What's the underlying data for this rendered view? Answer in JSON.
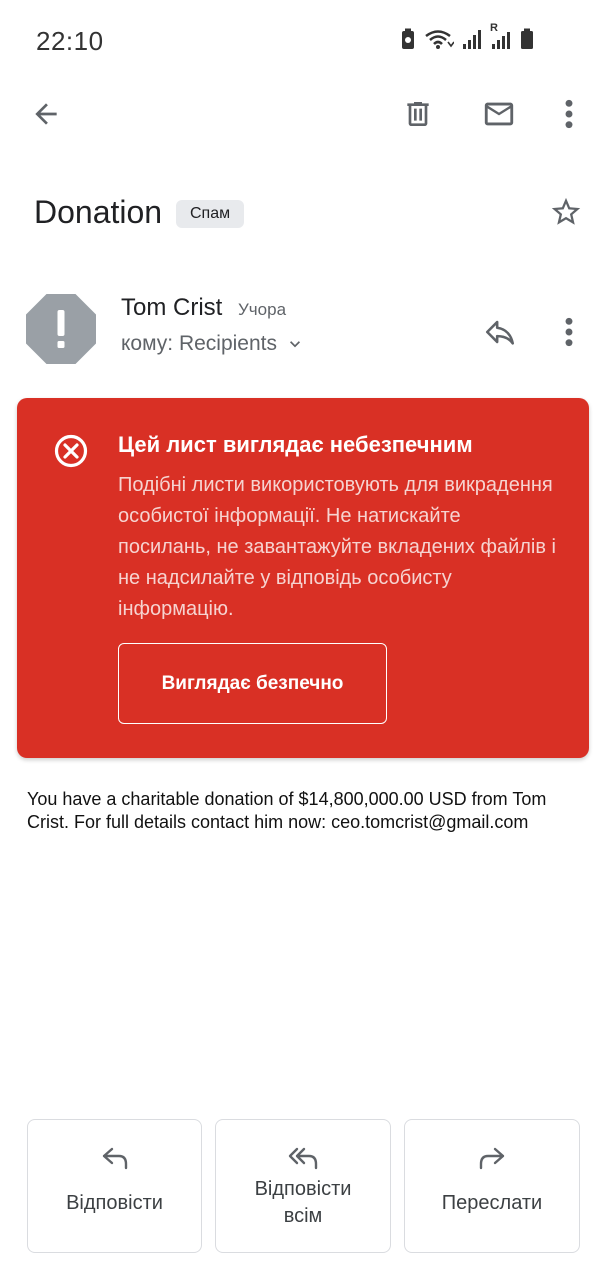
{
  "status_bar": {
    "time": "22:10",
    "icons": [
      "battery-saver-icon",
      "wifi-icon",
      "signal-icon",
      "signal-roaming-icon",
      "battery-icon"
    ],
    "roaming_label": "R"
  },
  "toolbar": {
    "icons": [
      "back-arrow-icon",
      "delete-icon",
      "mark-unread-icon",
      "more-vert-icon"
    ]
  },
  "subject": {
    "title": "Donation",
    "label": "Спам",
    "star_icon": "star-outline-icon"
  },
  "sender": {
    "name": "Tom Crist",
    "date": "Учора",
    "recipients": "кому: Recipients",
    "avatar_icon": "warning-octagon-icon",
    "avatar_color": "#9aa0a6"
  },
  "warning": {
    "title": "Цей лист виглядає небезпечним",
    "body": "Подібні листи використовують для викрадення особистої інформації. Не натискайте посилань, не завантажуйте вкладених файлів і не надсилайте у відповідь особисту інформацію.",
    "safe_button": "Виглядає безпечно",
    "background_color": "#d93025"
  },
  "message": {
    "body": "You have a charitable donation of $14,800,000.00 USD from Tom Crist. For full details contact him now: ceo.tomcrist@gmail.com"
  },
  "actions": {
    "reply": "Відповісти",
    "reply_all_line1": "Відповісти",
    "reply_all_line2": "всім",
    "forward": "Переслати"
  }
}
